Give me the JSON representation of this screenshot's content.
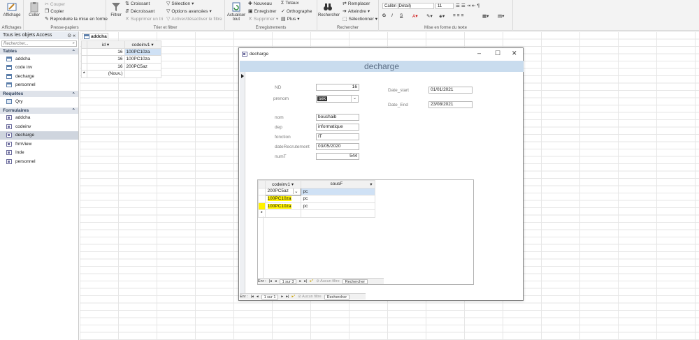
{
  "ribbon": {
    "affichage": "Affichage",
    "coller": "Coller",
    "couper": "Couper",
    "copier": "Copier",
    "reproduire": "Reproduire la mise en forme",
    "presse": "Presse-papiers",
    "affichages": "Affichages",
    "filtrer": "Filtrer",
    "croissant": "Croissant",
    "decroissant": "Décroissant",
    "supprimer_tri": "Supprimer un tri",
    "selection": "Sélection",
    "options_avancees": "Options avancées",
    "activer_filtre": "Activer/désactiver le filtre",
    "trier_filtrer": "Trier et filtrer",
    "actualiser": "Actualiser tout",
    "nouveau": "Nouveau",
    "enregistrer": "Enregistrer",
    "supprimer": "Supprimer",
    "totaux": "Totaux",
    "orthographe": "Orthographe",
    "plus": "Plus",
    "enregistrements": "Enregistrements",
    "rechercher": "Rechercher",
    "remplacer": "Remplacer",
    "atteindre": "Atteindre",
    "selectionner": "Sélectionner",
    "rechercher_grp": "Rechercher",
    "font_name": "Calibri (Détail)",
    "font_size": "11",
    "mise_en_forme": "Mise en forme du texte"
  },
  "nav": {
    "title": "Tous les objets Access",
    "search_placeholder": "Rechercher...",
    "sections": {
      "tables": "Tables",
      "requetes": "Requêtes",
      "formulaires": "Formulaires"
    },
    "tables": [
      "addcha",
      "code inv",
      "decharge",
      "personnel"
    ],
    "requetes": [
      "Qry"
    ],
    "formulaires": [
      "addcha",
      "codeinv",
      "decharge",
      "frmView",
      "Inde",
      "personnel"
    ]
  },
  "doc_tab": "addcha",
  "datasheet": {
    "headers": [
      "id",
      "codeinv1"
    ],
    "rows": [
      [
        "16",
        "100PC10za"
      ],
      [
        "16",
        "100PC10za"
      ],
      [
        "16",
        "200PC5az"
      ]
    ],
    "new_row": "(Nouv.)"
  },
  "form": {
    "window_title": "decharge",
    "header": "decharge",
    "fields": {
      "nd_label": "ND",
      "nd_value": "16",
      "prenom_label": "prenom",
      "prenom_value": "sek",
      "nom_label": "nom",
      "nom_value": "bouchaib",
      "dep_label": "dep",
      "dep_value": "informatique",
      "fonction_label": "fonction",
      "fonction_value": "IT",
      "daterec_label": "dateRecrutement",
      "daterec_value": "03/05/2020",
      "numt_label": "numT",
      "numt_value": "544",
      "datestart_label": "Date_start",
      "datestart_value": "01/01/2021",
      "dateend_label": "Date_End",
      "dateend_value": "23/08/2021"
    },
    "subform": {
      "headers": [
        "codeinv1",
        "sousF"
      ],
      "rows": [
        [
          "200PC5az",
          "pc"
        ],
        [
          "100PC10za",
          "pc"
        ],
        [
          "100PC10za",
          "pc"
        ]
      ],
      "nav_label": "Enr :",
      "position": "1 sur 3",
      "filter": "Aucun filtre",
      "search": "Rechercher"
    },
    "main_nav": {
      "label": "Enr :",
      "position": "1 sur 1",
      "filter": "Aucun filtre",
      "search": "Rechercher"
    }
  }
}
